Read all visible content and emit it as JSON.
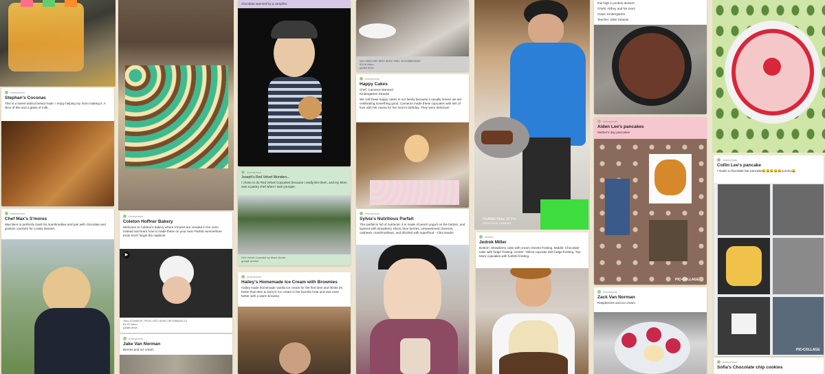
{
  "meta_label": "Anonymous",
  "cards": {
    "c1_title": "Stephan's Coconac",
    "c1_text": "This is a sweet walnut bread made. I enjoy helping my mom making it. A slice of this and a glass of milk...",
    "c2_title": "Chef Max's S'mores",
    "c2_text": "Max likes to perfectly toast his marshmallow and pair with chocolate and graham crackers for a tasty dessert.",
    "c3_title": "Coleton Hoffner Bakery",
    "c3_text": "Welcome to Coleton's bakery where s'mores are created in the oven instead and learn how to make these on your own! Parfait summertime treat! Don't forget the napkins!",
    "c3_cap": "Jnko DCIM0CIF 7FIGD 47E2 8296 C3F1D66DAC12",
    "c3_cap2": "01:22 video",
    "c3_cap3": "padlet drive",
    "c4_title": "Jake Van Norman",
    "c4_text": "Berries and ice cream",
    "c5_text": "chocolate warmed by a campfire.",
    "c6_text": "Joseph's Red Velvet Wonders...",
    "c6_text2": "I chose to do Red Velvet Cupcakes because I really like them, and my Mom was a pastry chef when I was younger.",
    "c6_cap": "Red Velvet Cupcake by Marie Andre",
    "c6_cap2": "google photos",
    "c7_title": "Hailey's Homemade Ice Cream with Brownies",
    "c7_text": "Hailey made homemade vanilla ice cream for the first time and thinks it's better than Ben & Jerry's! Ice cream is her favorite treat and was even better with a warm brownie.",
    "c8_cap": "Inlm 38847460 8033 4DDC 9981 4210288638404",
    "c8_cap2": "03:18 video",
    "c8_cap3": "padlet drive",
    "c9_title": "Happy Cakes",
    "c9_text": "Chef: Cameron Barnard\nKindergarten Strauss",
    "c9_text2": "We call these happy cakes in our family because it usually means we are celebrating something good. Cameron made these cupcakes with lots of love with her mama for her mom's birthday. They were delicious!",
    "c10_title": "Sylvia's Nutritious Parfait",
    "c10_text": "This parfait is full of nutrients. It is made of peach yogurt on the bottom, and layered with strawberry slices, blue berries, unsweetened cheerios, cashews, marshmallows, and drizzled with superfood - Chia seeds!",
    "c11_title": "Jedrek Miller",
    "c11_text": "Bottom: Strawberry cake with cream cheese frosting. Middle: Chocolate cake with fudge frosting. Center: Yellow cupcake with fudge frosting. Top: More cupcakes with funfetti frosting.",
    "c11_label": "Jedrek",
    "c12_top1": "this high in protein dessert.",
    "c12_top2": "Chefs: Abhey and his mom",
    "c12_top3": "Class: Kindergarten",
    "c12_top4": "Teacher: Miss Strauss",
    "c13_title": "Aiden Lee's pancakes",
    "c13_text": "Mother's day pancakes",
    "c14_title": "Zack Van Norman",
    "c14_text": "Raspberries and ice cream",
    "c15_title": "Collin Lee's pancake",
    "c15_text": "I made a chocolate bar pancake😀😀😀😀😀yummy😛",
    "c16_title": "Sofia's Chocolate chip cookies",
    "phone_wm1": "HUAWEI Mate 10 Pro",
    "phone_wm2": "LEICA DUAL CAMERA",
    "collage_wm": "PIC•COLLAGE"
  },
  "colors": {
    "board_bg": "#eee6d3",
    "card_pink": "#f7c7d0",
    "card_green": "#cfe8cf",
    "card_lavender": "#d8c8e8"
  }
}
